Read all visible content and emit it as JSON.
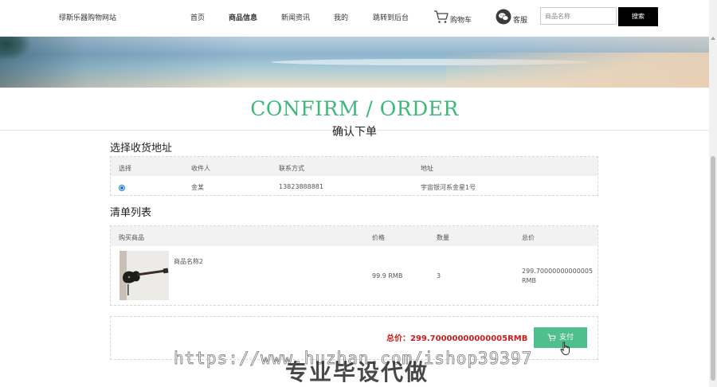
{
  "header": {
    "site_title": "缪斯乐器购物网站",
    "nav": [
      "首页",
      "商品信息",
      "新闻资讯",
      "我的",
      "跳转到后台"
    ],
    "cart_label": "购物车",
    "service_label": "客服",
    "search_placeholder": "商品名称",
    "search_button": "搜索"
  },
  "page": {
    "title_en": "CONFIRM / ORDER",
    "title_cn": "确认下单"
  },
  "address_section": {
    "heading": "选择收货地址",
    "columns": [
      "选择",
      "收件人",
      "联系方式",
      "地址"
    ],
    "rows": [
      {
        "selected": true,
        "recipient": "金某",
        "phone": "13823888881",
        "address": "宇宙银河系金星1号"
      }
    ]
  },
  "items_section": {
    "heading": "清单列表",
    "columns": [
      "购买商品",
      "价格",
      "数量",
      "总价"
    ],
    "rows": [
      {
        "name": "商品名称2",
        "price": "99.9 RMB",
        "quantity": "3",
        "total_value": "299.70000000000005",
        "total_unit": "RMB"
      }
    ]
  },
  "summary": {
    "total_text": "总价：299.70000000000005RMB",
    "pay_button": "支付"
  },
  "watermark": {
    "url": "https://www.huzhan.com/ishop39397",
    "text": "专业毕设代做"
  },
  "colors": {
    "accent_green": "#3cb878",
    "pay_button": "#4fc08d",
    "total_red": "#c91c1c"
  },
  "icons": [
    "cart-icon",
    "wechat-icon",
    "hand-cursor-icon"
  ]
}
